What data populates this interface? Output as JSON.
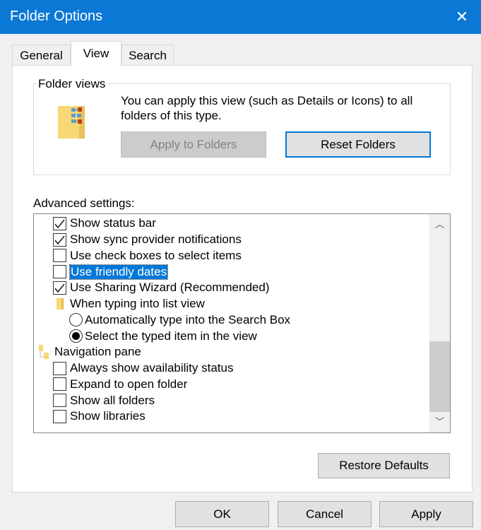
{
  "window": {
    "title": "Folder Options",
    "close_icon": "close-icon",
    "accent": "#0078d7"
  },
  "tabs": [
    {
      "label": "General",
      "selected": false
    },
    {
      "label": "View",
      "selected": true
    },
    {
      "label": "Search",
      "selected": false
    }
  ],
  "folder_views": {
    "label": "Folder views",
    "description": "You can apply this view (such as Details or Icons) to all folders of this type.",
    "apply_label": "Apply to Folders",
    "apply_enabled": false,
    "reset_label": "Reset Folders"
  },
  "advanced": {
    "label": "Advanced settings:",
    "items": [
      {
        "type": "checkbox",
        "label": "Show status bar",
        "checked": true,
        "level": 1
      },
      {
        "type": "checkbox",
        "label": "Show sync provider notifications",
        "checked": true,
        "level": 1
      },
      {
        "type": "checkbox",
        "label": "Use check boxes to select items",
        "checked": false,
        "level": 1
      },
      {
        "type": "checkbox",
        "label": "Use friendly dates",
        "checked": false,
        "level": 1,
        "selected": true
      },
      {
        "type": "checkbox",
        "label": "Use Sharing Wizard (Recommended)",
        "checked": true,
        "level": 1
      },
      {
        "type": "folder",
        "label": "When typing into list view",
        "level": 1
      },
      {
        "type": "radio",
        "label": "Automatically type into the Search Box",
        "checked": false,
        "level": 2
      },
      {
        "type": "radio",
        "label": "Select the typed item in the view",
        "checked": true,
        "level": 2
      },
      {
        "type": "folder",
        "label": "Navigation pane",
        "level": 0
      },
      {
        "type": "checkbox",
        "label": "Always show availability status",
        "checked": false,
        "level": 1
      },
      {
        "type": "checkbox",
        "label": "Expand to open folder",
        "checked": false,
        "level": 1
      },
      {
        "type": "checkbox",
        "label": "Show all folders",
        "checked": false,
        "level": 1
      },
      {
        "type": "checkbox",
        "label": "Show libraries",
        "checked": false,
        "level": 1
      }
    ]
  },
  "buttons": {
    "restore": "Restore Defaults",
    "ok": "OK",
    "cancel": "Cancel",
    "apply": "Apply"
  }
}
